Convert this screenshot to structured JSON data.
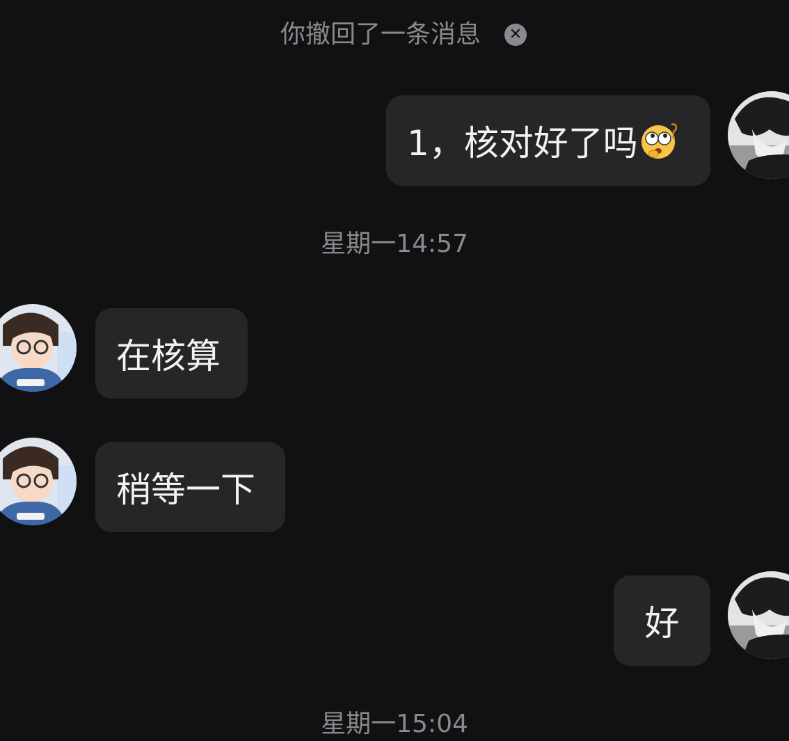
{
  "system": {
    "recall_text": "你撤回了一条消息",
    "recall_close_icon": "close-circle-icon"
  },
  "timestamps": [
    "星期一14:57",
    "星期一15:04"
  ],
  "messages": [
    {
      "sender": "me",
      "text": "1，核对好了吗",
      "emoji": "thinking-question-emoji",
      "avatar": "anime-boy-avatar"
    },
    {
      "sender": "other",
      "text": "在核算",
      "avatar": "girl-with-glasses-avatar"
    },
    {
      "sender": "other",
      "text": "稍等一下",
      "avatar": "girl-with-glasses-avatar"
    },
    {
      "sender": "me",
      "text": "好",
      "avatar": "anime-boy-avatar"
    }
  ],
  "colors": {
    "background": "#111113",
    "bubble": "#262628",
    "bubble_text": "#f2f2f2",
    "system_text": "#8a8a8e"
  }
}
